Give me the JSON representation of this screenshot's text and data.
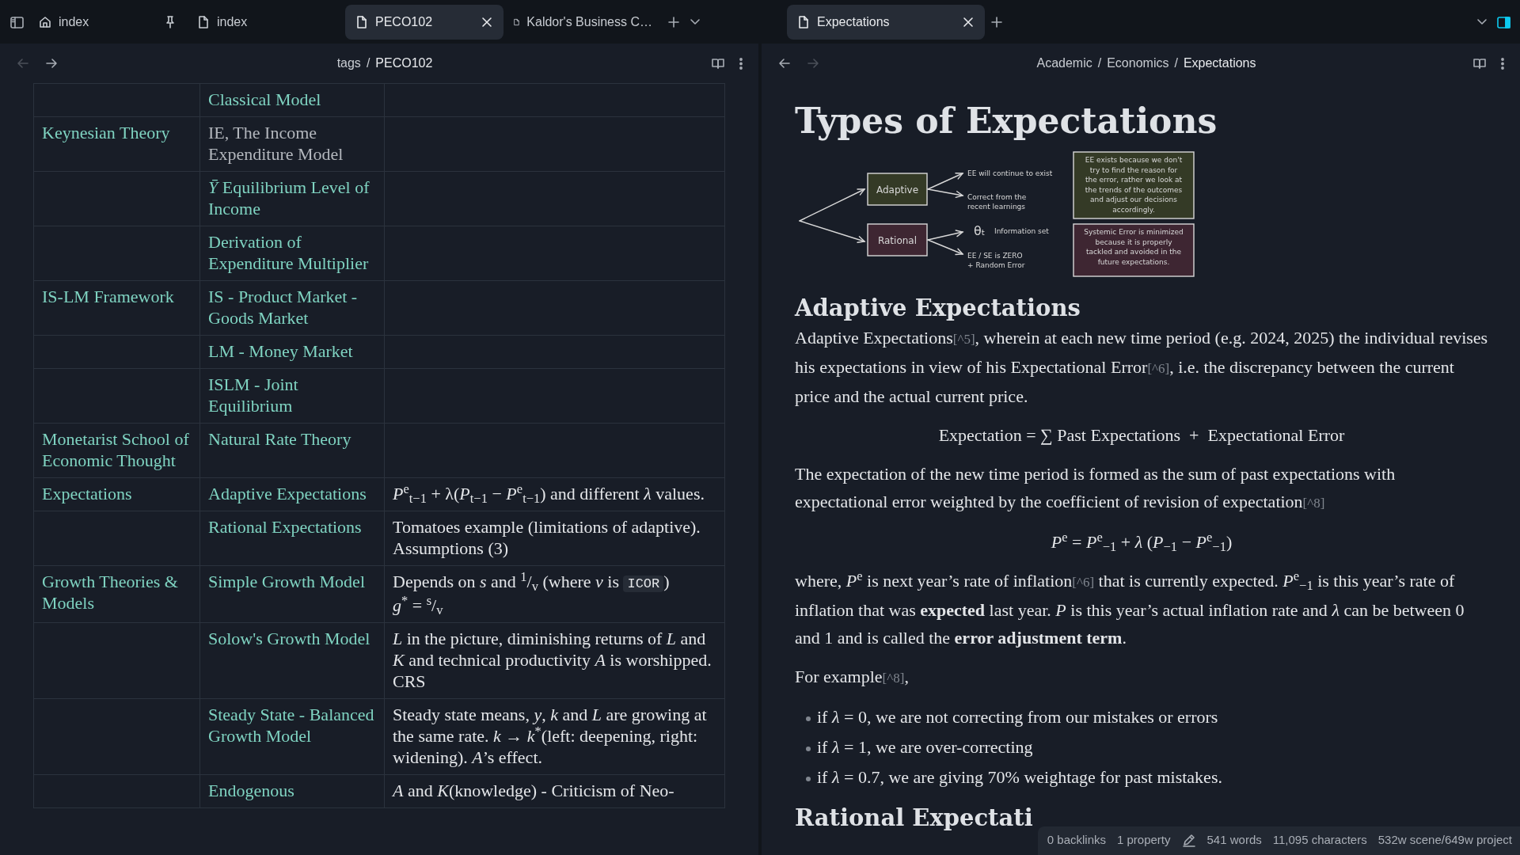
{
  "tab_bar": {
    "groups": [
      {
        "tabs": [
          {
            "label": "index",
            "kind": "home",
            "pinned": true,
            "selected": false
          },
          {
            "label": "index",
            "kind": "file",
            "pinned": false,
            "selected": false
          },
          {
            "label": "PECO102",
            "kind": "file",
            "pinned": false,
            "selected": true
          },
          {
            "label": "Kaldor's Business C…",
            "kind": "file",
            "pinned": false,
            "selected": false
          }
        ],
        "controls": [
          {
            "kind": "new_tab"
          },
          {
            "kind": "tab_list"
          }
        ]
      },
      {
        "tabs": [
          {
            "label": "Expectations",
            "kind": "file",
            "pinned": false,
            "selected": true
          }
        ],
        "controls": [
          {
            "kind": "new_tab"
          }
        ]
      }
    ]
  },
  "left_pane": {
    "nav": {
      "back_disabled": true,
      "forward_disabled": false
    },
    "breadcrumbs": [
      "tags",
      "PECO102"
    ],
    "separator": "/",
    "table": {
      "rows": [
        {
          "subtopic": {
            "text": "Classical Model",
            "resolved": true
          }
        },
        {
          "topic": "Keynesian Theory",
          "subtopic": {
            "text": "IE, The Income Expenditure Model",
            "resolved": false
          }
        },
        {
          "subtopic": {
            "text": "*Ȳ* Equilibrium Level of Income",
            "resolved": true
          }
        },
        {
          "subtopic": {
            "text": "Derivation of Expenditure Multiplier",
            "resolved": true
          }
        },
        {
          "topic": "IS-LM Framework",
          "subtopic": {
            "text": "IS - Product Market - Goods Market",
            "resolved": true
          }
        },
        {
          "subtopic": {
            "text": "LM - Money Market",
            "resolved": true
          }
        },
        {
          "subtopic": {
            "text": "ISLM - Joint Equilibrium",
            "resolved": true
          }
        },
        {
          "topic": "Monetarist School of Economic Thought",
          "subtopic": {
            "text": "Natural Rate Theory",
            "resolved": true
          }
        },
        {
          "topic": "Expectations",
          "subtopic": {
            "text": "Adaptive Expectations",
            "resolved": true
          },
          "notes": [
            [
              {
                "kind": "text",
                "text": "*P*$^{e}$$_{t−1}$ + λ(*P*$_{t−1}$ − *P*$^{e}$$_{t−1}$) and different *λ* values."
              }
            ]
          ]
        },
        {
          "subtopic": {
            "text": "Rational Expectations",
            "resolved": true
          },
          "notes": [
            [
              {
                "kind": "text",
                "text": "Tomatoes example (limitations of adaptive). Assumptions (3)"
              }
            ]
          ]
        },
        {
          "topic": "Growth Theories & Models",
          "subtopic": {
            "text": "Simple Growth Model",
            "resolved": true
          },
          "notes": [
            [
              {
                "kind": "text",
                "text": "Depends on *s* and $^{1}$/$_{v}$ (where *v* is "
              },
              {
                "kind": "code",
                "text": "ICOR"
              },
              {
                "kind": "text",
                "text": ")"
              }
            ],
            [
              {
                "kind": "text",
                "text": "*g*$^{*}$ = $^{s}$/$_{v}$"
              }
            ]
          ]
        },
        {
          "subtopic": {
            "text": "Solow's Growth Model",
            "resolved": true
          },
          "notes": [
            [
              {
                "kind": "text",
                "text": "*L* in the picture, diminishing returns of *L* and *K* and technical productivity *A* is worshipped. CRS"
              }
            ]
          ]
        },
        {
          "subtopic": {
            "text": "Steady State - Balanced Growth Model",
            "resolved": true
          },
          "notes": [
            [
              {
                "kind": "text",
                "text": "Steady state means, *y*, *k* and *L* are growing at the same rate. *k* → *k*$^{*}$(left: deepening, right: widening). *A*’s effect."
              }
            ]
          ]
        },
        {
          "subtopic": {
            "text": "Endogenous",
            "resolved": true
          },
          "notes": [
            [
              {
                "kind": "text",
                "text": "*A* and *K*(knowledge) - Criticism of Neo-"
              }
            ]
          ]
        }
      ]
    }
  },
  "right_pane": {
    "nav": {
      "back_disabled": false,
      "forward_disabled": true
    },
    "breadcrumbs": [
      "Academic",
      "Economics",
      "Expectations"
    ],
    "separator": "/",
    "blocks": [
      {
        "kind": "h1",
        "text": "Types of Expectations"
      },
      {
        "kind": "diagram",
        "nodes": [
          {
            "label": "Adaptive",
            "color": "#343a26",
            "outcomes": [
              [
                "EE will continue to exist"
              ],
              [
                "Correct from the",
                "recent learnings"
              ]
            ],
            "note": [
              "EE exists because we don't",
              "try to find the reason for",
              "the error, rather we look at",
              "the trends of the outcomes",
              "and adjust our decisions",
              "accordingly."
            ]
          },
          {
            "label": "Rational",
            "color": "#3e2632",
            "outcomes": [
              [
                "θₜ",
                "Information set"
              ],
              [
                "EE / SE is ZERO",
                "+ Random Error"
              ]
            ],
            "note": [
              "Systemic Error is minimized",
              "because it is properly",
              "tackled and avoided in the",
              "future expectations."
            ]
          }
        ]
      },
      {
        "kind": "h2",
        "text": "Adaptive Expectations"
      },
      {
        "kind": "paragraph",
        "segments": [
          {
            "kind": "text",
            "text": "Adaptive Expectations"
          },
          {
            "kind": "ref",
            "text": "[^5]"
          },
          {
            "kind": "text",
            "text": ", wherein at each new time period (e.g. 2024, 2025) the individual revises his expectations in view of his Expectational Error"
          },
          {
            "kind": "ref",
            "text": "[^6]"
          },
          {
            "kind": "text",
            "text": ", i.e. the discrepancy between the current price and the actual current price."
          }
        ]
      },
      {
        "kind": "equation",
        "text": "Expectation = ∑ Past Expectations  +  Expectational Error"
      },
      {
        "kind": "paragraph",
        "segments": [
          {
            "kind": "text",
            "text": "The expectation of the new time period is formed as the sum of past expectations with expectational error weighted by the coefficient of revision of expectation"
          },
          {
            "kind": "ref",
            "text": "[^8]"
          }
        ]
      },
      {
        "kind": "equation",
        "text": "*P*$^{e}$ = *P*$^{e}$$_{−1}$ + *λ* (*P*$_{−1}$ − *P*$^{e}$$_{−1}$)"
      },
      {
        "kind": "paragraph",
        "segments": [
          {
            "kind": "text",
            "text": "where, *P*$^{e}$ is next year’s rate of inflation"
          },
          {
            "kind": "ref",
            "text": "[^6]"
          },
          {
            "kind": "text",
            "text": " that is currently expected. *P*$^{e}$$_{−1}$ is this year’s rate of inflation that was **expected** last year. *P* is this year’s actual inflation rate and *λ* can be between 0 and 1 and is called the **error adjustment term**."
          }
        ]
      },
      {
        "kind": "paragraph",
        "segments": [
          {
            "kind": "text",
            "text": "For example"
          },
          {
            "kind": "ref",
            "text": "[^8]"
          },
          {
            "kind": "text",
            "text": ","
          }
        ]
      },
      {
        "kind": "bullets",
        "items": [
          "if *λ* = 0, we are not correcting from our mistakes or errors",
          "if *λ* = 1, we are over-correcting",
          "if *λ* = 0.7, we are giving 70% weightage for past mistakes."
        ]
      },
      {
        "kind": "h2",
        "text": "Rational Expectati"
      }
    ]
  },
  "status_bar": {
    "items": [
      {
        "kind": "text",
        "text": "0 backlinks"
      },
      {
        "kind": "text",
        "text": "1 property"
      },
      {
        "kind": "edit"
      },
      {
        "kind": "text",
        "text": "541 words"
      },
      {
        "kind": "text",
        "text": "11,095 characters"
      },
      {
        "kind": "text",
        "text": "532w scene/649w project"
      }
    ]
  }
}
